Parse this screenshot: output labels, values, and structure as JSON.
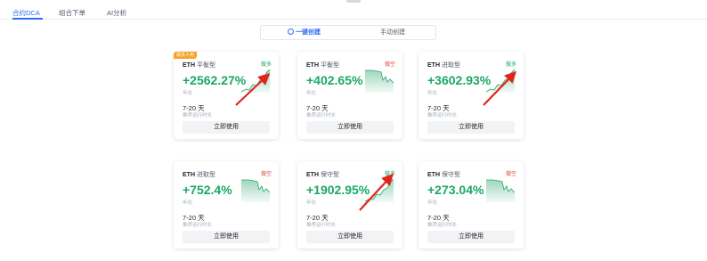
{
  "tabs": [
    {
      "label": "合约DCA",
      "active": true
    },
    {
      "label": "组合下单",
      "active": false
    },
    {
      "label": "AI分析",
      "active": false
    }
  ],
  "mode": {
    "auto_label": "一键创建",
    "manual_label": "手动创建"
  },
  "cards": [
    {
      "asset": "ETH",
      "strategy": "平衡型",
      "direction": "做多",
      "direction_type": "long",
      "rate": "+2562.27%",
      "rate_label": "年化",
      "range": "7-20 天",
      "range_label": "推荐运行时长",
      "button": "立即使用",
      "badge": "最多人用",
      "trend": "up"
    },
    {
      "asset": "ETH",
      "strategy": "平衡型",
      "direction": "做空",
      "direction_type": "short",
      "rate": "+402.65%",
      "rate_label": "年化",
      "range": "7-20 天",
      "range_label": "推荐运行时长",
      "button": "立即使用",
      "badge": "",
      "trend": "down"
    },
    {
      "asset": "ETH",
      "strategy": "进取型",
      "direction": "做多",
      "direction_type": "long",
      "rate": "+3602.93%",
      "rate_label": "年化",
      "range": "7-20 天",
      "range_label": "推荐运行时长",
      "button": "立即使用",
      "badge": "",
      "trend": "up"
    },
    {
      "asset": "ETH",
      "strategy": "进取型",
      "direction": "做空",
      "direction_type": "short",
      "rate": "+752.4%",
      "rate_label": "年化",
      "range": "7-20 天",
      "range_label": "推荐运行时长",
      "button": "立即使用",
      "badge": "",
      "trend": "down"
    },
    {
      "asset": "ETH",
      "strategy": "保守型",
      "direction": "做多",
      "direction_type": "long",
      "rate": "+1902.95%",
      "rate_label": "年化",
      "range": "7-20 天",
      "range_label": "推荐运行时长",
      "button": "立即使用",
      "badge": "",
      "trend": "up"
    },
    {
      "asset": "ETH",
      "strategy": "保守型",
      "direction": "做空",
      "direction_type": "short",
      "rate": "+273.04%",
      "rate_label": "年化",
      "range": "7-20 天",
      "range_label": "推荐运行时长",
      "button": "立即使用",
      "badge": "",
      "trend": "down"
    }
  ],
  "colors": {
    "accent": "#2e6cf6",
    "long": "#1aa864",
    "short": "#e2463c",
    "badge": "#f7a325",
    "annotation_arrow": "#e3241b"
  },
  "icons": {
    "auto_create": "sparkle-icon"
  }
}
